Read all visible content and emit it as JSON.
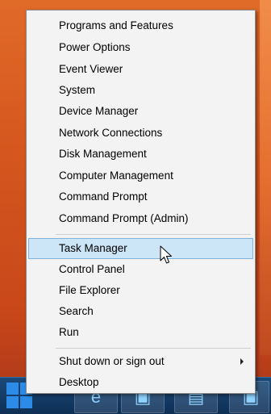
{
  "menu": {
    "items": [
      {
        "label": "Programs and Features"
      },
      {
        "label": "Power Options"
      },
      {
        "label": "Event Viewer"
      },
      {
        "label": "System"
      },
      {
        "label": "Device Manager"
      },
      {
        "label": "Network Connections"
      },
      {
        "label": "Disk Management"
      },
      {
        "label": "Computer Management"
      },
      {
        "label": "Command Prompt"
      },
      {
        "label": "Command Prompt (Admin)"
      },
      {
        "label": "Task Manager"
      },
      {
        "label": "Control Panel"
      },
      {
        "label": "File Explorer"
      },
      {
        "label": "Search"
      },
      {
        "label": "Run"
      },
      {
        "label": "Shut down or sign out"
      },
      {
        "label": "Desktop"
      }
    ],
    "hovered_item": "Task Manager"
  },
  "taskbar": {
    "apps": [
      {
        "icon": "internet-explorer-icon"
      },
      {
        "icon": "store-icon"
      },
      {
        "icon": "file-explorer-icon"
      },
      {
        "icon": "app-icon"
      }
    ]
  },
  "colors": {
    "menu_background": "#f3f3f3",
    "hover_background": "#cce5f7",
    "hover_border": "#7db4df",
    "taskbar": "#0e2f55",
    "wallpaper": "#d4551e"
  }
}
